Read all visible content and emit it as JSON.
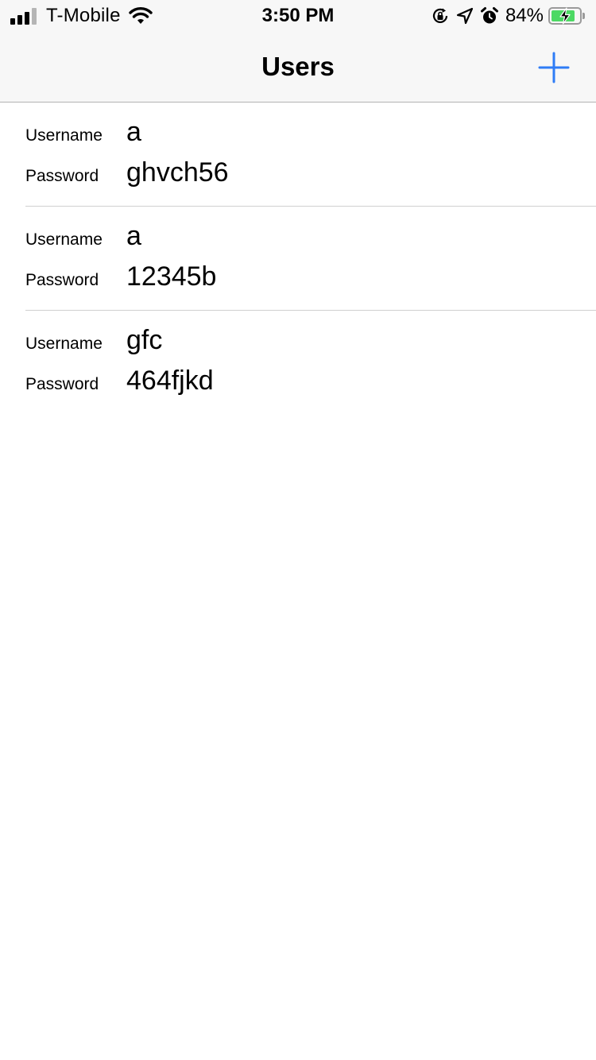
{
  "status_bar": {
    "carrier": "T-Mobile",
    "time": "3:50 PM",
    "battery_percent": "84%",
    "battery_level": 0.84,
    "icons": [
      "signal-icon",
      "wifi-icon",
      "orientation-lock-icon",
      "location-arrow-icon",
      "alarm-icon",
      "battery-charging-icon"
    ]
  },
  "nav": {
    "title": "Users",
    "add_icon": "plus-icon",
    "accent_color": "#2f7cf6"
  },
  "users": [
    {
      "username_label": "Username",
      "username": "a",
      "password_label": "Password",
      "password": "ghvch56"
    },
    {
      "username_label": "Username",
      "username": "a",
      "password_label": "Password",
      "password": "12345b"
    },
    {
      "username_label": "Username",
      "username": "gfc",
      "password_label": "Password",
      "password": "464fjkd"
    }
  ]
}
